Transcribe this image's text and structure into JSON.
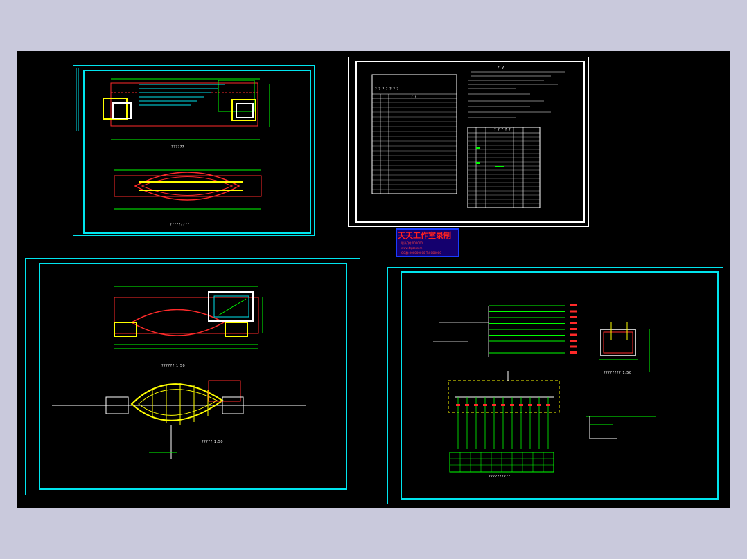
{
  "viewer": {
    "background": "#c9c9dc",
    "canvas": "#000000"
  },
  "colors": {
    "frame": "#00e5ee",
    "red": "#ff2a2a",
    "yellow": "#ffff00",
    "green": "#00ff00",
    "white": "#ffffff",
    "stamp_blue": "#1a3cff"
  },
  "sheets": {
    "top_left": {
      "caption_plan": "??????",
      "caption_section": "?????????"
    },
    "top_right": {
      "title": "? ?",
      "left_table_header": "? ? ? ? ? ? ?",
      "left_table_sub": "? ?",
      "right_table_title": "? ? ? ? ?"
    },
    "bottom_left": {
      "caption_plan": "??????  1:50",
      "caption_section": "?????  1:50"
    },
    "bottom_right": {
      "caption_system": "??????????",
      "caption_detail": "????????  1:50"
    }
  },
  "stamp": {
    "title": "天天工作室录制",
    "line1": "联系QQ:000000",
    "line2": "www.ttgzs.com",
    "line3": "QQ群:000000000 Tel:000000"
  }
}
